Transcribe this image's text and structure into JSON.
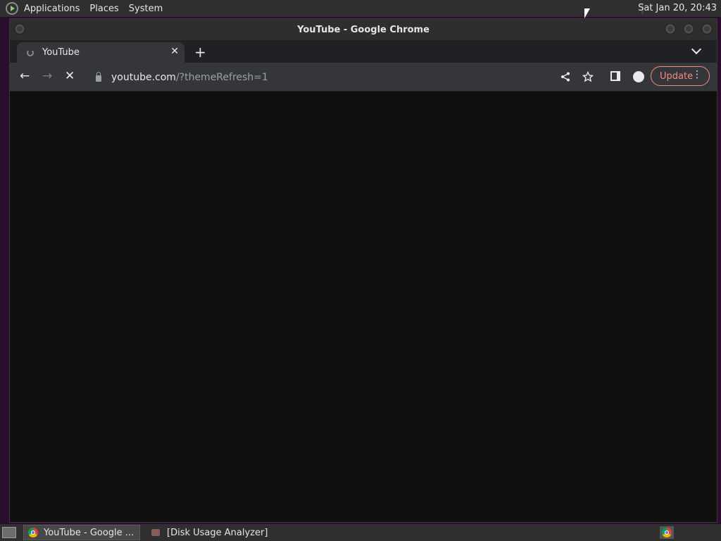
{
  "top_panel": {
    "menus": [
      "Applications",
      "Places",
      "System"
    ],
    "clock": "Sat Jan 20, 20:43"
  },
  "window": {
    "title": "YouTube - Google Chrome"
  },
  "browser": {
    "tab": {
      "label": "YouTube",
      "close": "✕"
    },
    "new_tab": "+",
    "url": {
      "host": "youtube.com",
      "rest": "/?themeRefresh=1"
    },
    "update_label": "Update",
    "nav": {
      "back": "←",
      "forward": "→",
      "stop": "✕"
    },
    "icons": {
      "share": "share-icon",
      "bookmark": "star-icon",
      "menu": "⋮"
    }
  },
  "taskbar": {
    "tasks": [
      {
        "label": "YouTube - Google ...",
        "active": true,
        "icon": "chrome-icon"
      },
      {
        "label": "[Disk Usage Analyzer]",
        "active": false,
        "icon": "disk-usage-analyzer-icon"
      }
    ]
  },
  "colors": {
    "update_accent": "#f28b82",
    "content_bg": "#0f0f10",
    "toolbar_bg": "#35363a"
  }
}
